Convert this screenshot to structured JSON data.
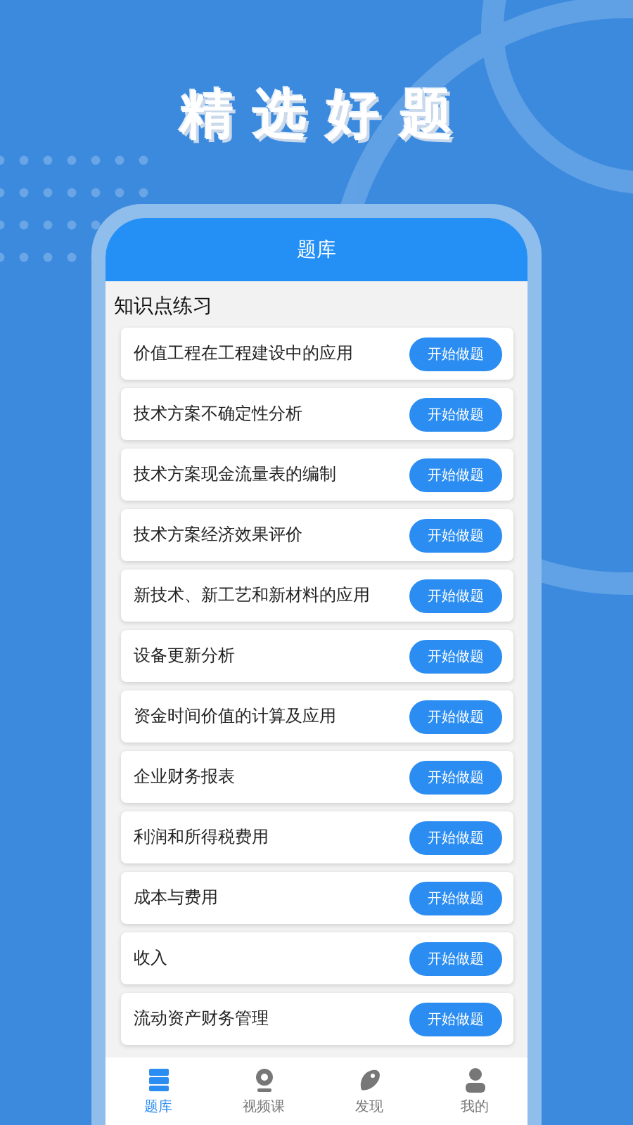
{
  "headline": "精选好题",
  "screen": {
    "title": "题库",
    "section_title": "知识点练习",
    "topics": [
      {
        "name": "价值工程在工程建设中的应用",
        "action": "开始做题"
      },
      {
        "name": "技术方案不确定性分析",
        "action": "开始做题"
      },
      {
        "name": "技术方案现金流量表的编制",
        "action": "开始做题"
      },
      {
        "name": "技术方案经济效果评价",
        "action": "开始做题"
      },
      {
        "name": "新技术、新工艺和新材料的应用",
        "action": "开始做题"
      },
      {
        "name": "设备更新分析",
        "action": "开始做题"
      },
      {
        "name": "资金时间价值的计算及应用",
        "action": "开始做题"
      },
      {
        "name": "企业财务报表",
        "action": "开始做题"
      },
      {
        "name": "利润和所得税费用",
        "action": "开始做题"
      },
      {
        "name": "成本与费用",
        "action": "开始做题"
      },
      {
        "name": "收入",
        "action": "开始做题"
      },
      {
        "name": "流动资产财务管理",
        "action": "开始做题"
      }
    ],
    "tabs": [
      {
        "label": "题库",
        "kind": "books",
        "selected": true
      },
      {
        "label": "视频课",
        "kind": "camera",
        "selected": false
      },
      {
        "label": "发现",
        "kind": "planet",
        "selected": false
      },
      {
        "label": "我的",
        "kind": "person",
        "selected": false
      }
    ]
  }
}
